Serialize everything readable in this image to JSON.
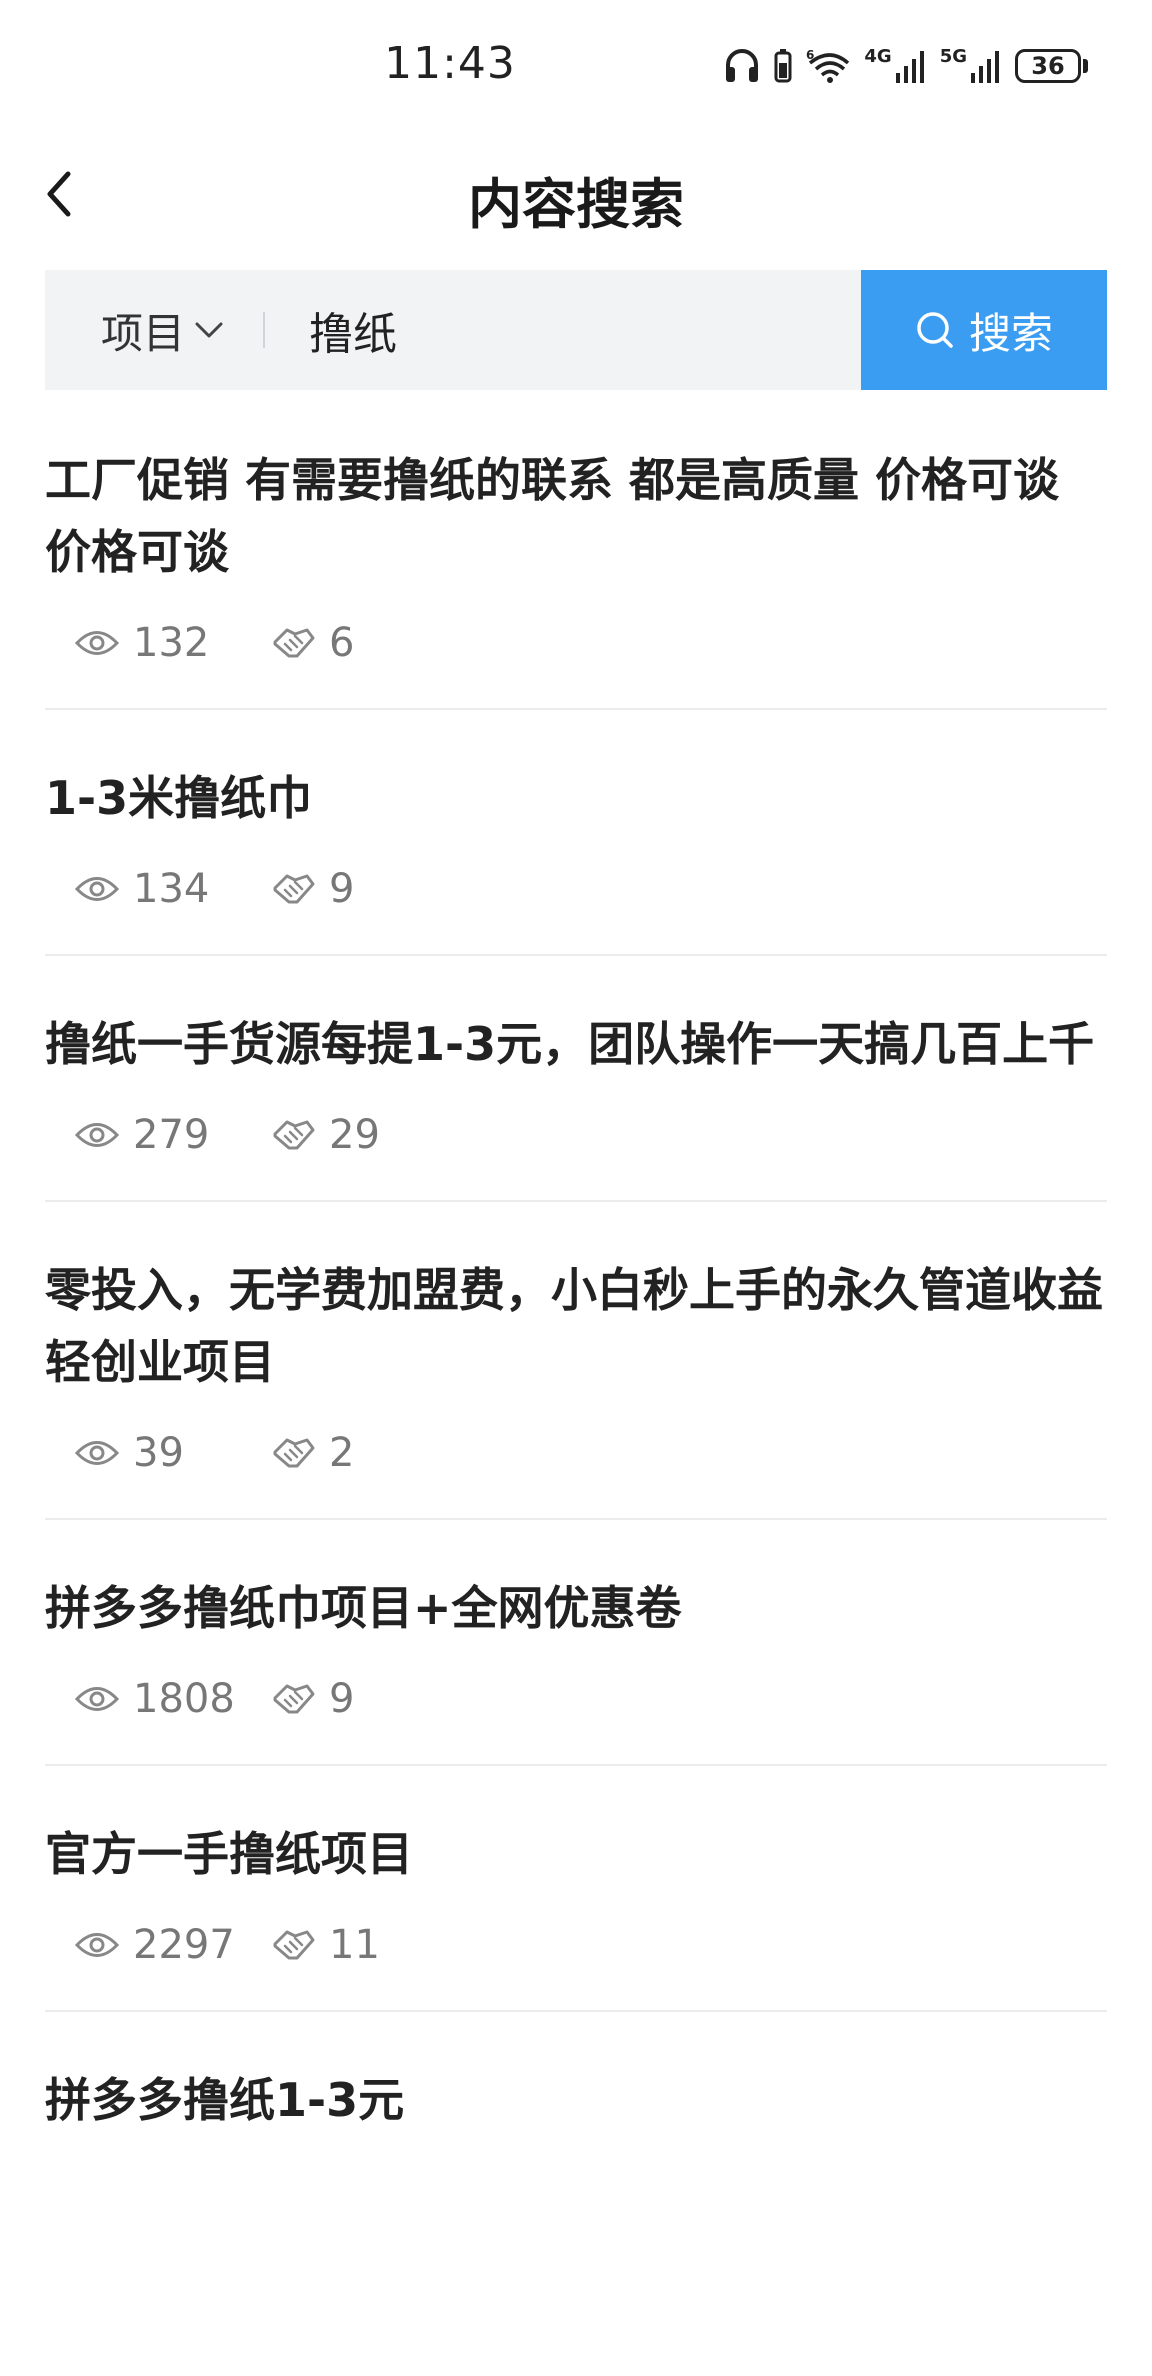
{
  "status_bar": {
    "time": "11:43",
    "signal_1_label": "4G",
    "signal_2_label": "5G",
    "wifi_label": "6",
    "battery": "36"
  },
  "header": {
    "title": "内容搜索",
    "back_icon": "chevron-left-icon"
  },
  "search": {
    "category": "项目",
    "query": "撸纸",
    "button_label": "搜索"
  },
  "results": [
    {
      "title": "工厂促销 有需要撸纸的联系 都是高质量 价格可谈 价格可谈",
      "views": "132",
      "likes": "6"
    },
    {
      "title": "1-3米撸纸巾",
      "views": "134",
      "likes": "9"
    },
    {
      "title": "撸纸一手货源每提1-3元，团队操作一天搞几百上千",
      "views": "279",
      "likes": "29"
    },
    {
      "title": "零投入，无学费加盟费，小白秒上手的永久管道收益轻创业项目",
      "views": "39",
      "likes": "2"
    },
    {
      "title": "拼多多撸纸巾项目+全网优惠卷",
      "views": "1808",
      "likes": "9"
    },
    {
      "title": "官方一手撸纸项目",
      "views": "2297",
      "likes": "11"
    },
    {
      "title": "拼多多撸纸1-3元"
    }
  ],
  "colors": {
    "accent": "#3a9df1",
    "search_bg": "#f2f3f5",
    "meta_text": "#777777",
    "divider": "#ececec"
  }
}
